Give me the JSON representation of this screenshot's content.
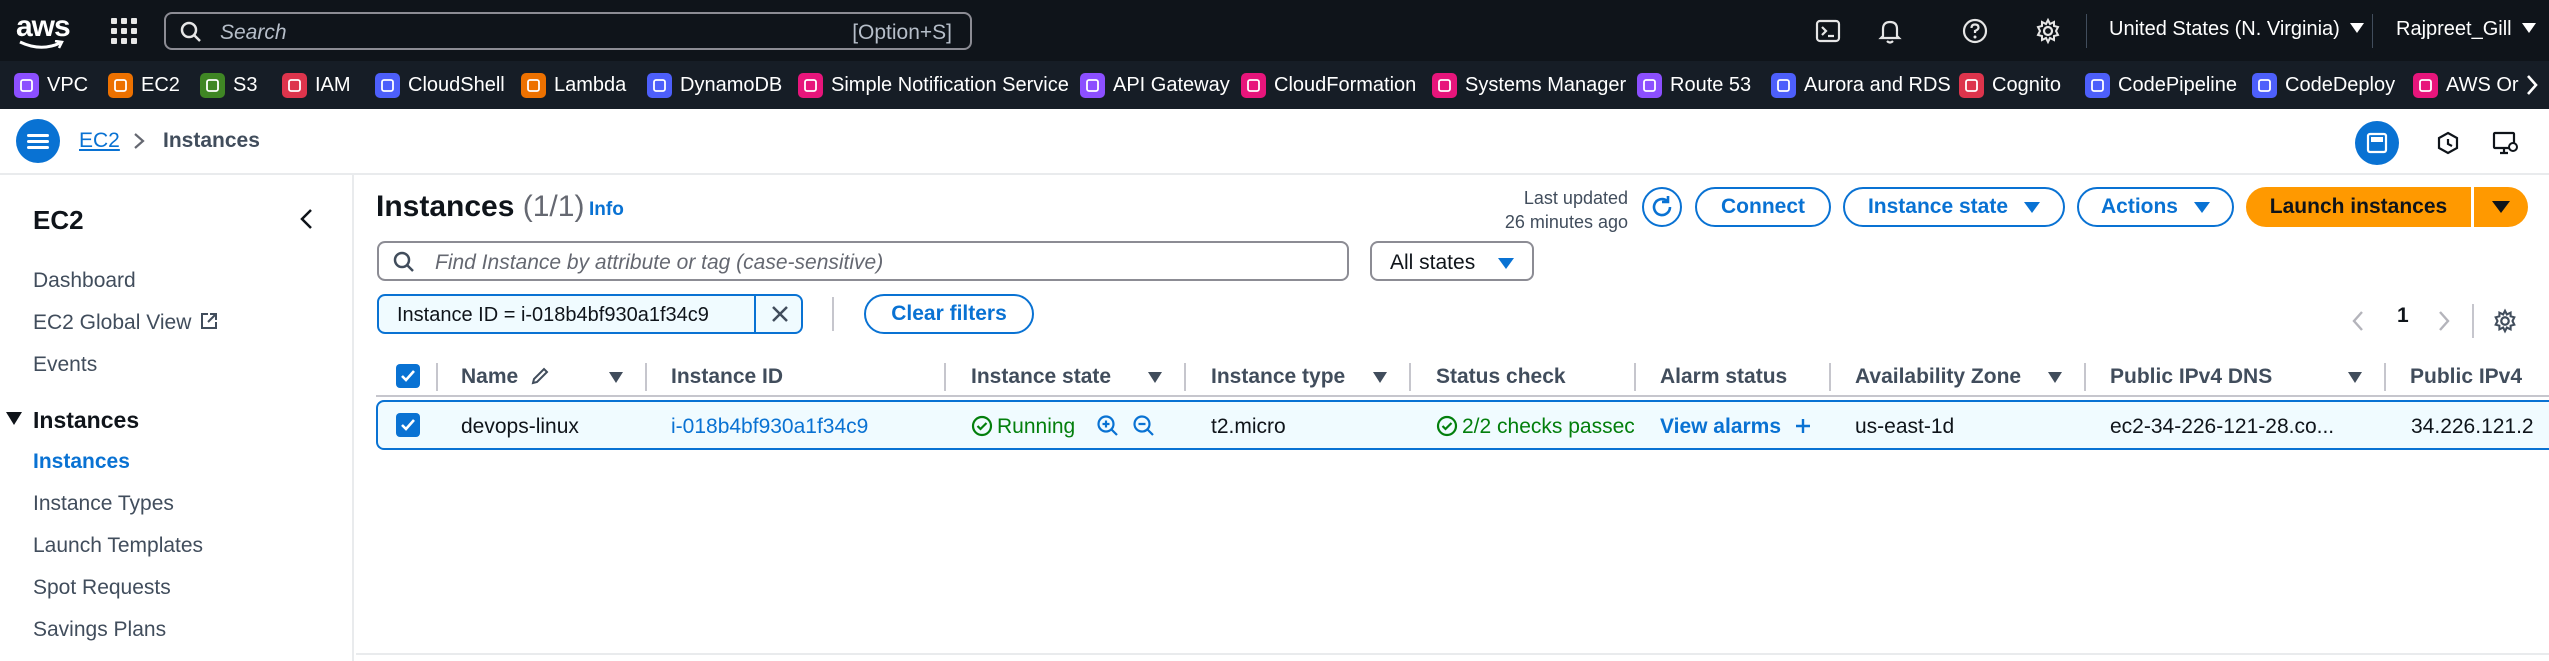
{
  "topbar": {
    "logo": "aws",
    "search_placeholder": "Search",
    "search_shortcut": "[Option+S]",
    "region": "United States (N. Virginia)",
    "user": "Rajpreet_Gill",
    "icons": [
      "apps-grid-icon",
      "cloudshell-icon",
      "notifications-bell-icon",
      "help-icon",
      "settings-gear-icon"
    ]
  },
  "favorites": [
    {
      "label": "VPC",
      "color": "#8c4fff"
    },
    {
      "label": "EC2",
      "color": "#ed7100"
    },
    {
      "label": "S3",
      "color": "#3f8624"
    },
    {
      "label": "IAM",
      "color": "#dd344c"
    },
    {
      "label": "CloudShell",
      "color": "#4d5ffb"
    },
    {
      "label": "Lambda",
      "color": "#ed7100"
    },
    {
      "label": "DynamoDB",
      "color": "#4d5ffb"
    },
    {
      "label": "Simple Notification Service",
      "color": "#e7157b"
    },
    {
      "label": "API Gateway",
      "color": "#8c4fff"
    },
    {
      "label": "CloudFormation",
      "color": "#e7157b"
    },
    {
      "label": "Systems Manager",
      "color": "#e7157b"
    },
    {
      "label": "Route 53",
      "color": "#8c4fff"
    },
    {
      "label": "Aurora and RDS",
      "color": "#4d5ffb"
    },
    {
      "label": "Cognito",
      "color": "#dd344c"
    },
    {
      "label": "CodePipeline",
      "color": "#4d5ffb"
    },
    {
      "label": "CodeDeploy",
      "color": "#4d5ffb"
    },
    {
      "label": "AWS Or",
      "color": "#e7157b"
    }
  ],
  "breadcrumb": {
    "parent": "EC2",
    "current": "Instances"
  },
  "sidenav": {
    "title": "EC2",
    "items_top": [
      "Dashboard",
      "EC2 Global View",
      "Events"
    ],
    "section": "Instances",
    "section_items": [
      "Instances",
      "Instance Types",
      "Launch Templates",
      "Spot Requests",
      "Savings Plans"
    ],
    "active": "Instances"
  },
  "main": {
    "title": "Instances",
    "count": "(1/1)",
    "info": "Info",
    "last_updated_line1": "Last updated",
    "last_updated_line2": "26 minutes ago",
    "connect": "Connect",
    "instance_state": "Instance state",
    "actions": "Actions",
    "launch": "Launch instances",
    "find_placeholder": "Find Instance by attribute or tag (case-sensitive)",
    "states_filter": "All states",
    "filter_token": "Instance ID = i-018b4bf930a1f34c9",
    "clear_filters": "Clear filters",
    "page": "1"
  },
  "table": {
    "columns": [
      "Name",
      "Instance ID",
      "Instance state",
      "Instance type",
      "Status check",
      "Alarm status",
      "Availability Zone",
      "Public IPv4 DNS",
      "Public IPv4"
    ],
    "rows": [
      {
        "name": "devops-linux",
        "instance_id": "i-018b4bf930a1f34c9",
        "state": "Running",
        "type": "t2.micro",
        "status_check": "2/2 checks passec",
        "alarm": "View alarms",
        "az": "us-east-1d",
        "dns": "ec2-34-226-121-28.co...",
        "ipv4": "34.226.121.2"
      }
    ]
  }
}
